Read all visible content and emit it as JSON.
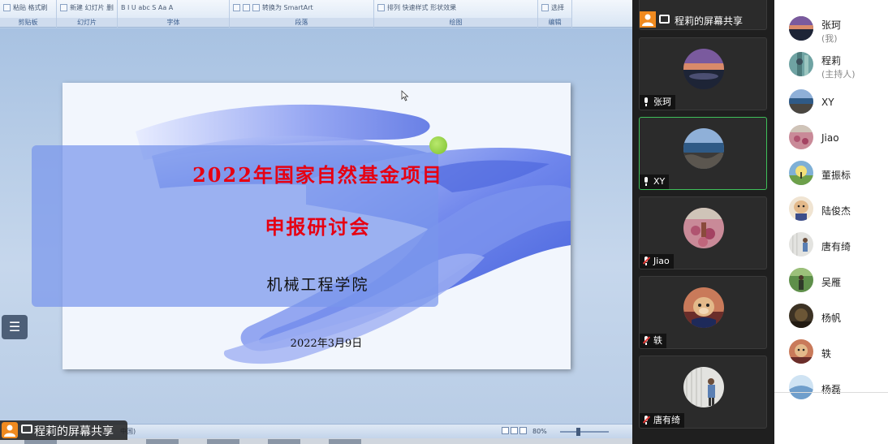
{
  "ribbon": {
    "groups": [
      {
        "label": "剪贴板",
        "tools": "粘贴  格式刷"
      },
      {
        "label": "幻灯片",
        "tools": "新建 幻灯片  删除"
      },
      {
        "label": "字体",
        "tools": "B  I  U  abc  S  Aa  A"
      },
      {
        "label": "段落",
        "tools": "转换为 SmartArt"
      },
      {
        "label": "绘图",
        "tools": "排列  快速样式  形状效果"
      },
      {
        "label": "编辑",
        "tools": "选择"
      }
    ]
  },
  "slide": {
    "title_line1": "2022年国家自然基金项目",
    "title_line2": "申报研讨会",
    "subtitle": "机械工程学院",
    "date": "2022年3月9日",
    "title_color": "#e60012"
  },
  "statusbar": {
    "language": "中国)",
    "zoom": "80%"
  },
  "share_overlay": {
    "label": "程莉的屏幕共享"
  },
  "videos": {
    "top_tile_label": "程莉的屏幕共享",
    "tiles": [
      {
        "name": "张珂",
        "mic": "on",
        "photo": "sunset-lake"
      },
      {
        "name": "XY",
        "mic": "on",
        "photo": "sea-rocks",
        "speaking": true
      },
      {
        "name": "Jiao",
        "mic": "muted",
        "photo": "pink-flowers"
      },
      {
        "name": "轶",
        "mic": "muted",
        "photo": "dog"
      },
      {
        "name": "唐有绮",
        "mic": "muted",
        "photo": "person-white-wall"
      }
    ]
  },
  "participants": [
    {
      "name": "张珂",
      "role": "(我)"
    },
    {
      "name": "程莉",
      "role": "(主持人)"
    },
    {
      "name": "XY",
      "role": ""
    },
    {
      "name": "Jiao",
      "role": ""
    },
    {
      "name": "董振标",
      "role": ""
    },
    {
      "name": "陆俊杰",
      "role": ""
    },
    {
      "name": "唐有绮",
      "role": ""
    },
    {
      "name": "吴雁",
      "role": ""
    },
    {
      "name": "杨帆",
      "role": ""
    },
    {
      "name": "轶",
      "role": ""
    },
    {
      "name": "杨磊",
      "role": ""
    }
  ]
}
